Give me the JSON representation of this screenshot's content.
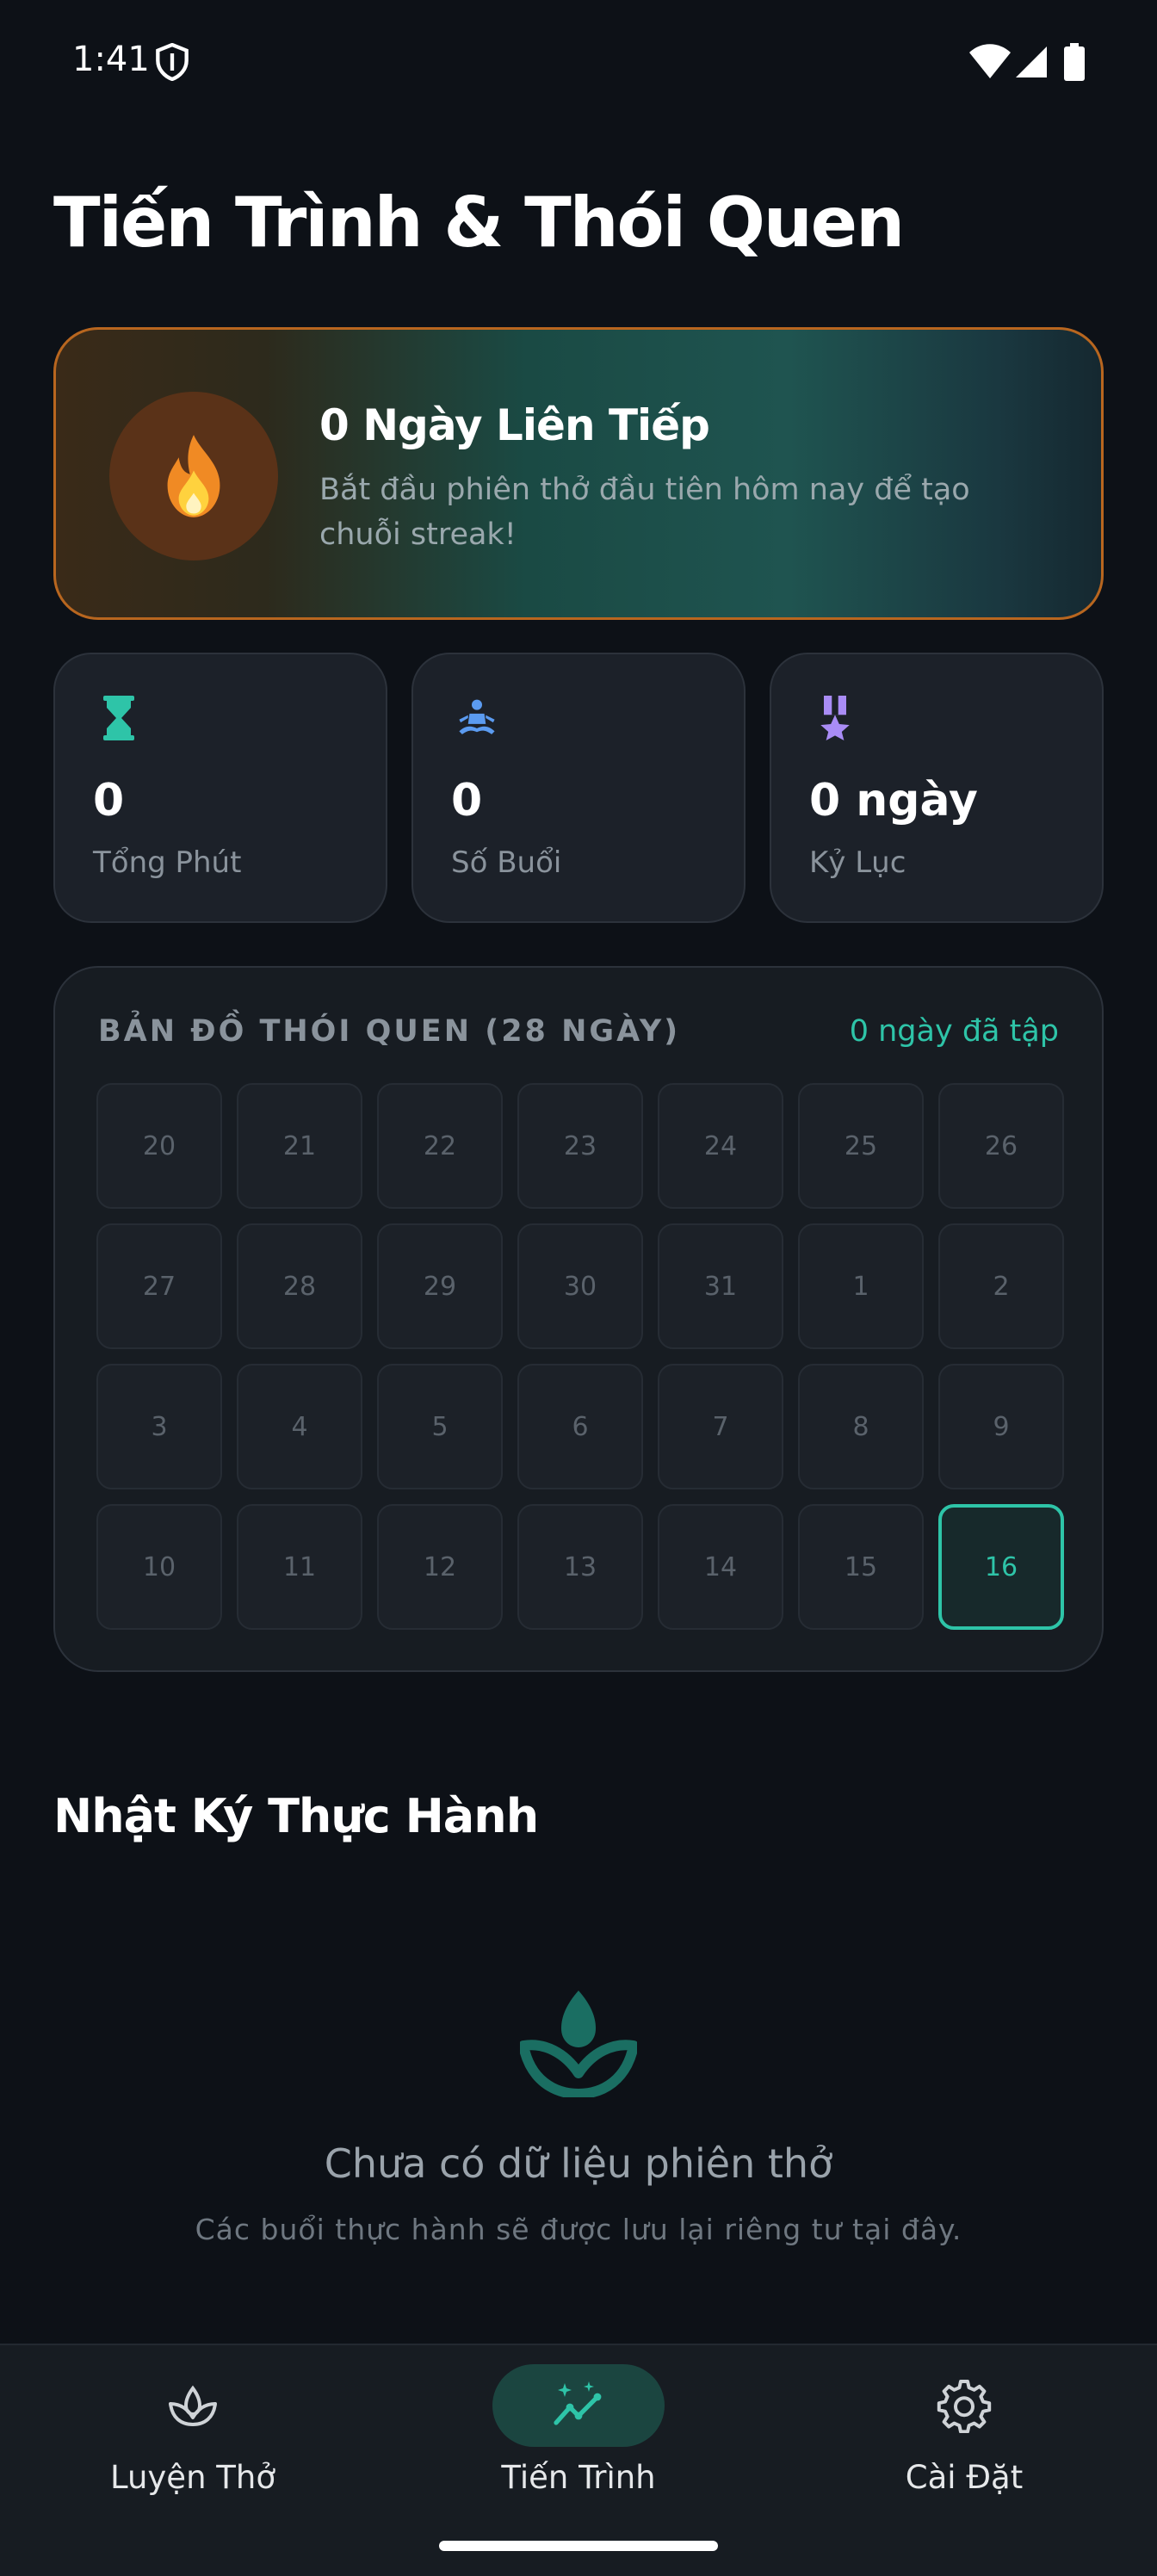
{
  "status": {
    "time": "1:41"
  },
  "header": {
    "title": "Tiến Trình & Thói Quen"
  },
  "streak": {
    "title": "0 Ngày Liên Tiếp",
    "subtitle": "Bắt đầu phiên thở đầu tiên hôm nay để tạo chuỗi streak!",
    "icon": "flame-icon"
  },
  "stats": [
    {
      "value": "0",
      "label": "Tổng Phút",
      "icon": "hourglass-icon",
      "color": "#2ec4a8"
    },
    {
      "value": "0",
      "label": "Số Buổi",
      "icon": "meditation-icon",
      "color": "#5b9bf0"
    },
    {
      "value": "0 ngày",
      "label": "Kỷ Lục",
      "icon": "medal-icon",
      "color": "#a98cf5"
    }
  ],
  "habit_map": {
    "title": "BẢN ĐỒ THÓI QUEN (28 NGÀY)",
    "count_label": "0 ngày đã tập",
    "days": [
      "20",
      "21",
      "22",
      "23",
      "24",
      "25",
      "26",
      "27",
      "28",
      "29",
      "30",
      "31",
      "1",
      "2",
      "3",
      "4",
      "5",
      "6",
      "7",
      "8",
      "9",
      "10",
      "11",
      "12",
      "13",
      "14",
      "15",
      "16"
    ],
    "today": "16"
  },
  "log": {
    "title": "Nhật Ký Thực Hành",
    "empty_title": "Chưa có dữ liệu phiên thở",
    "empty_sub": "Các buổi thực hành sẽ được lưu lại riêng tư tại đây."
  },
  "nav": {
    "items": [
      {
        "label": "Luyện Thở",
        "icon": "lotus-icon",
        "active": false
      },
      {
        "label": "Tiến Trình",
        "icon": "trend-sparkle-icon",
        "active": true
      },
      {
        "label": "Cài Đặt",
        "icon": "gear-icon",
        "active": false
      }
    ]
  },
  "colors": {
    "accent": "#2ec4a8",
    "background": "#0d1117",
    "streak_border": "#b8661f"
  }
}
